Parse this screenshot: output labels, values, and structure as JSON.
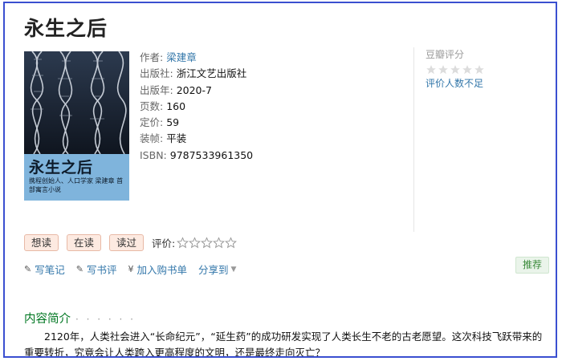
{
  "book": {
    "title": "永生之后",
    "cover": {
      "title": "永生之后",
      "subtitle": "携程创始人、人口学家 梁建章 首部寓言小说",
      "publisher_mark": "浙江文艺出版社"
    },
    "info": [
      {
        "label": "作者:",
        "value": "梁建章",
        "link": true
      },
      {
        "label": "出版社:",
        "value": "浙江文艺出版社",
        "link": false
      },
      {
        "label": "出版年:",
        "value": "2020-7",
        "link": false
      },
      {
        "label": "页数:",
        "value": "160",
        "link": false
      },
      {
        "label": "定价:",
        "value": "59",
        "link": false
      },
      {
        "label": "装帧:",
        "value": "平装",
        "link": false
      },
      {
        "label": "ISBN:",
        "value": "9787533961350",
        "link": false
      }
    ]
  },
  "rating": {
    "title": "豆瓣评分",
    "note": "评价人数不足",
    "stars_filled": 0,
    "stars_total": 5
  },
  "actions": {
    "want": "想读",
    "reading": "在读",
    "read": "读过",
    "rate_label": "评价:",
    "rate_stars": 5
  },
  "links": {
    "note": "写笔记",
    "review": "写书评",
    "cart": "加入购书单",
    "share": "分享到"
  },
  "recommend": "推荐",
  "intro": {
    "title": "内容简介",
    "dots": "· · · · · ·",
    "text": "2120年，人类社会进入“长命纪元”，“延生药”的成功研发实现了人类长生不老的古老愿望。这次科技飞跃带来的重要转折，究竟会让人类跨入更高程度的文明，还是最终走向灭亡？"
  },
  "colors": {
    "link": "#3377aa",
    "green": "#007722",
    "border": "#3a4fd0",
    "button_bg": "#fdeae1"
  }
}
